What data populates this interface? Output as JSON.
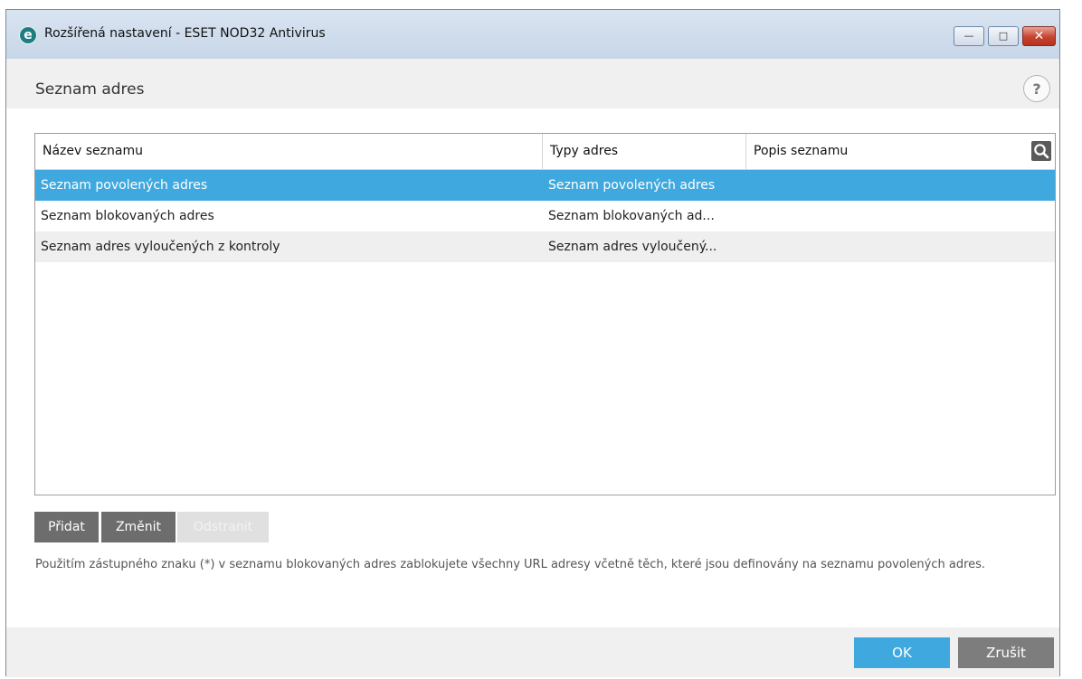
{
  "window": {
    "title": "Rozšířená nastavení - ESET NOD32 Antivirus",
    "app_icon_letter": "e",
    "controls": [
      "minimize-icon",
      "maximize-icon",
      "close-icon"
    ]
  },
  "page": {
    "title": "Seznam adres",
    "help_label": "?"
  },
  "table": {
    "columns": [
      "Název seznamu",
      "Typy adres",
      "Popis seznamu"
    ],
    "rows": [
      {
        "name": "Seznam povolených adres",
        "type": "Seznam povolených adres",
        "description": ""
      },
      {
        "name": "Seznam blokovaných adres",
        "type": "Seznam blokovaných ad...",
        "description": ""
      },
      {
        "name": "Seznam adres vyloučených z kontroly",
        "type": "Seznam adres vyloučený...",
        "description": ""
      }
    ],
    "selected_row_index": 0
  },
  "actions": {
    "add": "Přidat",
    "edit": "Změnit",
    "remove": "Odstranit"
  },
  "note": "Použitím zástupného znaku (*) v seznamu blokovaných adres zablokujete všechny URL adresy včetně těch, které jsou definovány na seznamu povolených adres.",
  "footer": {
    "ok": "OK",
    "cancel": "Zrušit"
  },
  "colors": {
    "accent": "#3fa9df",
    "button_gray": "#6d6d6d",
    "button_disabled": "#e0e0e0",
    "cancel_gray": "#7d7d7d"
  }
}
